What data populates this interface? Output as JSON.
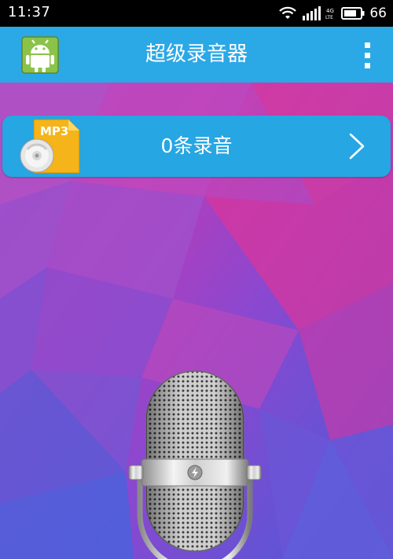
{
  "status_bar": {
    "time": "11:37",
    "network_label": "4G LTE",
    "battery": "66"
  },
  "app_bar": {
    "title": "超级录音器"
  },
  "recordings": {
    "label": "0条录音",
    "icon_text": "MP3"
  },
  "colors": {
    "app_bar": "#2ba8e6",
    "card": "#26a6e2",
    "status_bar": "#000000"
  },
  "icons": {
    "app": "android-icon",
    "menu": "more-vertical-icon",
    "recordings": "mp3-file-icon",
    "chevron": "chevron-right-icon",
    "mic": "microphone-icon"
  }
}
